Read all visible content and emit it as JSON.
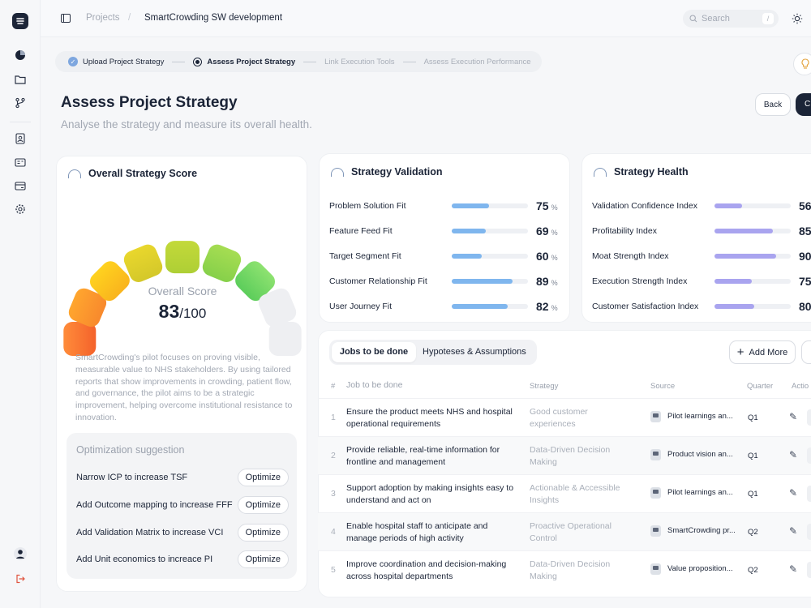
{
  "app": {
    "sidebar_icons": [
      "logo-icon",
      "pie-chart-icon",
      "folder-icon",
      "branch-icon",
      "contact-icon",
      "id-card-icon",
      "card-icon",
      "settings-icon",
      "user-avatar-icon",
      "logout-icon"
    ]
  },
  "header": {
    "breadcrumb": [
      "Projects",
      "SmartCrowding SW development"
    ],
    "search_placeholder": "Search",
    "search_shortcut": "/"
  },
  "stepper": {
    "steps": [
      {
        "label": "Upload Project Strategy",
        "state": "done"
      },
      {
        "label": "Assess Project Strategy",
        "state": "active"
      },
      {
        "label": "Link Execution Tools",
        "state": "pending"
      },
      {
        "label": "Assess Execution Performance",
        "state": "pending"
      }
    ]
  },
  "page": {
    "title": "Assess Project Strategy",
    "subtitle": "Analyse the strategy and measure its overall health.",
    "back_label": "Back",
    "continue_label": "C"
  },
  "overall": {
    "title": "Overall Strategy Score",
    "score_label": "Overall Score",
    "score": "83",
    "score_max": "/100",
    "segments_filled": 7,
    "segments_total": 9,
    "description": "SmartCrowding's pilot focuses on proving visible, measurable value to NHS stakeholders. By using tailored reports that show improvements in crowding, patient flow, and governance, the pilot aims to be a strategic improvement, helping overcome institutional resistance to innovation.",
    "optimization_title": "Optimization suggestion",
    "suggestions": [
      {
        "text": "Narrow ICP to increase TSF",
        "button": "Optimize"
      },
      {
        "text": "Add Outcome mapping to increase FFF",
        "button": "Optimize"
      },
      {
        "text": "Add Validation Matrix to increase VCI",
        "button": "Optimize"
      },
      {
        "text": "Add Unit economics to increace PI",
        "button": "Optimize"
      }
    ]
  },
  "validation": {
    "title": "Strategy Validation",
    "bar_color": "#7fb6ee",
    "items": [
      {
        "label": "Problem Solution Fit",
        "value": "75",
        "unit": "%"
      },
      {
        "label": "Feature Feed Fit",
        "value": "69",
        "unit": "%"
      },
      {
        "label": "Target Segment Fit",
        "value": "60",
        "unit": "%"
      },
      {
        "label": "Customer Relationship Fit",
        "value": "89",
        "unit": "%"
      },
      {
        "label": "User Journey Fit",
        "value": "82",
        "unit": "%"
      }
    ]
  },
  "health": {
    "title": "Strategy Health",
    "bar_color": "#a9a4ef",
    "items": [
      {
        "label": "Validation Confidence Index",
        "value": "56"
      },
      {
        "label": "Profitability Index",
        "value": "85"
      },
      {
        "label": "Moat Strength Index",
        "value": "90"
      },
      {
        "label": "Execution Strength Index",
        "value": "75"
      },
      {
        "label": "Customer Satisfaction Index",
        "value": "80"
      }
    ]
  },
  "jobs": {
    "tabs": [
      "Jobs to be done",
      "Hypoteses & Assumptions"
    ],
    "add_more": "Add More",
    "columns": [
      "#",
      "Job to be done",
      "Strategy",
      "Source",
      "Quarter",
      "Actio"
    ],
    "rows": [
      {
        "num": "1",
        "job": "Ensure the product meets NHS and hospital operational requirements",
        "strategy": "Good customer experiences",
        "source": "Pilot learnings an...",
        "quarter": "Q1"
      },
      {
        "num": "2",
        "job": "Provide reliable, real-time information for frontline and management",
        "strategy": "Data-Driven Decision Making",
        "source": "Product vision an...",
        "quarter": "Q1"
      },
      {
        "num": "3",
        "job": "Support adoption by making insights easy to understand and act on",
        "strategy": "Actionable & Accessible Insights",
        "source": "Pilot learnings an...",
        "quarter": "Q1"
      },
      {
        "num": "4",
        "job": "Enable hospital staff to anticipate and manage periods of high activity",
        "strategy": "Proactive Operational Control",
        "source": "SmartCrowding pr...",
        "quarter": "Q2"
      },
      {
        "num": "5",
        "job": "Improve coordination and decision-making across hospital departments",
        "strategy": "Data-Driven Decision Making",
        "source": "Value proposition...",
        "quarter": "Q2"
      }
    ]
  }
}
